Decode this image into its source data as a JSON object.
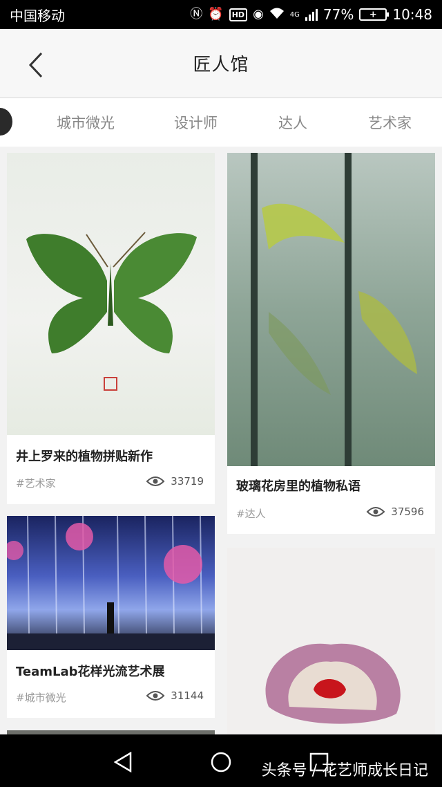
{
  "status": {
    "carrier": "中国移动",
    "network": "4G",
    "battery": "77%",
    "time": "10:48"
  },
  "header": {
    "title": "匠人馆"
  },
  "tabs": [
    {
      "label": "城市微光"
    },
    {
      "label": "设计师"
    },
    {
      "label": "达人"
    },
    {
      "label": "艺术家"
    }
  ],
  "cards": [
    {
      "title": "井上罗来的植物拼贴新作",
      "tag": "#艺术家",
      "views": "33719"
    },
    {
      "title": "玻璃花房里的植物私语",
      "tag": "#达人",
      "views": "37596"
    },
    {
      "title": "TeamLab花样光流艺术展",
      "tag": "#城市微光",
      "views": "31144"
    }
  ],
  "watermark": "头条号 / 花艺师成长日记"
}
